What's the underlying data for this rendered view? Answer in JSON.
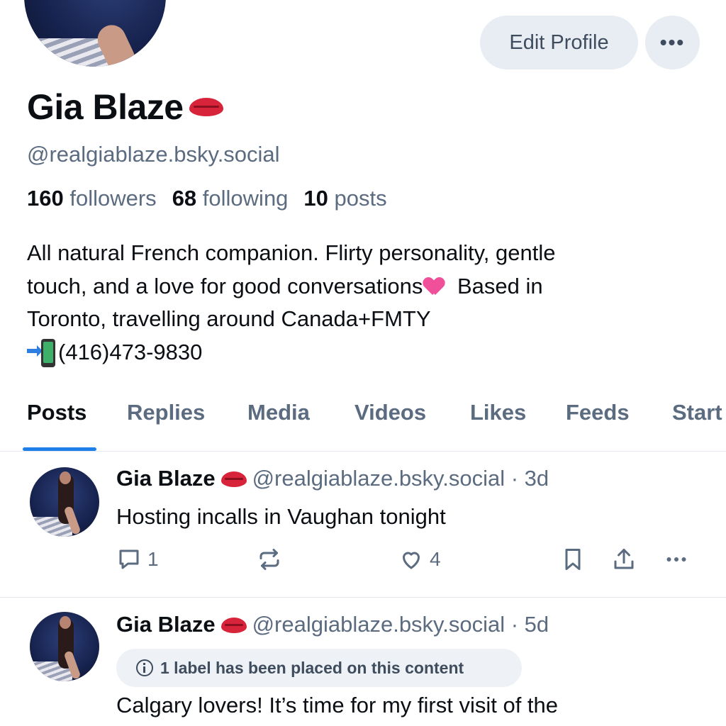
{
  "profile": {
    "display_name": "Gia Blaze",
    "handle": "@realgiablaze.bsky.social",
    "edit_label": "Edit Profile",
    "more_label": "•••",
    "stats": {
      "followers_count": "160",
      "followers_label": "followers",
      "following_count": "68",
      "following_label": "following",
      "posts_count": "10",
      "posts_label": "posts"
    },
    "bio": {
      "line1": "All natural French companion. Flirty personality, gentle",
      "line2a": "touch, and a love for good conversations",
      "line2b": " Based in",
      "line3": "Toronto, travelling around Canada+FMTY",
      "line4": "(416)473-9830"
    }
  },
  "tabs": [
    "Posts",
    "Replies",
    "Media",
    "Videos",
    "Likes",
    "Feeds",
    "Start"
  ],
  "posts": [
    {
      "author": "Gia Blaze",
      "meta": "@realgiablaze.bsky.social · 3d",
      "text": "Hosting incalls in Vaughan tonight",
      "replies": "1",
      "reposts": "",
      "likes": "4"
    },
    {
      "author": "Gia Blaze",
      "meta": "@realgiablaze.bsky.social · 5d",
      "label_notice": "1 label has been placed on this content",
      "text": "Calgary lovers! It’s time for my first visit of the"
    }
  ],
  "colors": {
    "accent": "#1e7fe8",
    "muted": "#5b6b80",
    "pill_bg": "#e8edf3"
  }
}
